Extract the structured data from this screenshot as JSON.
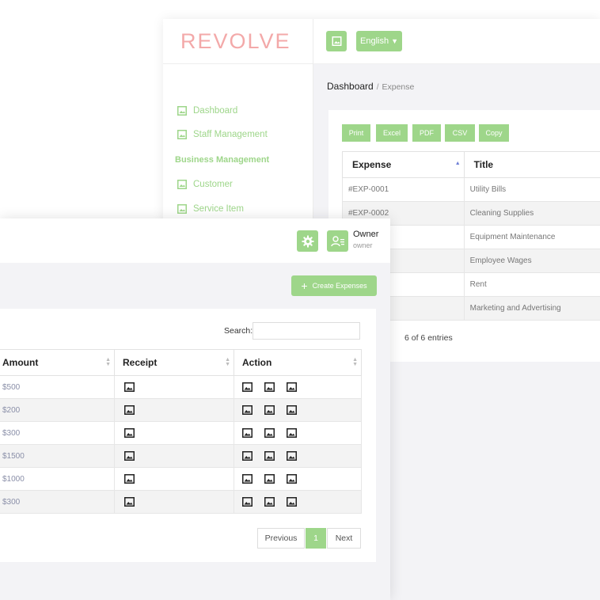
{
  "brand": {
    "logo_text": "REVOLVE",
    "accent": "#9ed68a",
    "logo_color": "#f3a9a9"
  },
  "back_window": {
    "sidebar": {
      "items_top": [
        {
          "label": "Dashboard",
          "icon": "image-icon"
        },
        {
          "label": "Staff Management",
          "icon": "image-icon"
        }
      ],
      "section_heading": "Business Management",
      "items_business": [
        {
          "label": "Customer",
          "icon": "image-icon"
        },
        {
          "label": "Service Item",
          "icon": "image-icon"
        }
      ]
    },
    "topbar": {
      "language": "English"
    },
    "breadcrumb": {
      "root": "Dashboard",
      "separator": "/",
      "current": "Expense"
    },
    "export_buttons": [
      "Print",
      "Excel",
      "PDF",
      "CSV",
      "Copy"
    ],
    "table": {
      "headers": [
        "Expense",
        "Title"
      ],
      "rows": [
        {
          "expense": "#EXP-0001",
          "title": "Utility Bills"
        },
        {
          "expense": "#EXP-0002",
          "title": "Cleaning Supplies"
        },
        {
          "expense": "",
          "title": "Equipment Maintenance"
        },
        {
          "expense": "",
          "title": "Employee Wages"
        },
        {
          "expense": "",
          "title": "Rent"
        },
        {
          "expense": "",
          "title": "Marketing and Advertising"
        }
      ]
    },
    "entries_info": "6 of 6 entries"
  },
  "front_window": {
    "user": {
      "name": "Owner",
      "role": "owner"
    },
    "create_button": "Create Expenses",
    "search_label": "Search:",
    "table": {
      "headers": [
        "Amount",
        "Receipt",
        "Action"
      ],
      "amounts": [
        "$500",
        "$200",
        "$300",
        "$1500",
        "$1000",
        "$300"
      ]
    },
    "pagination": {
      "previous": "Previous",
      "page": "1",
      "next": "Next"
    }
  }
}
